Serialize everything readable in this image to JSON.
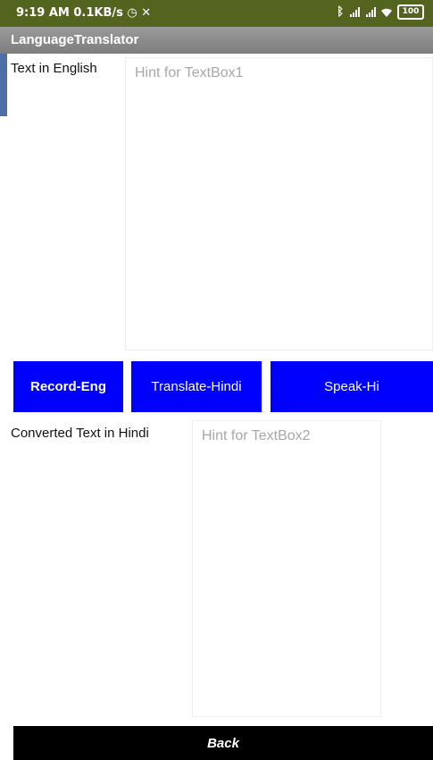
{
  "status_bar": {
    "time": "9:19 AM",
    "net_speed": "0.1KB/s",
    "alarm_icon": "alarm-icon",
    "x_icon": "✕",
    "battery": "100"
  },
  "app": {
    "title": "LanguageTranslator"
  },
  "english": {
    "label": "Text in English",
    "placeholder": "Hint for TextBox1"
  },
  "buttons": {
    "record": "Record-Eng",
    "translate": "Translate-Hindi",
    "speak": "Speak-Hi",
    "back": "Back"
  },
  "hindi": {
    "label": "Converted Text in Hindi",
    "placeholder": "Hint for TextBox2"
  },
  "colors": {
    "status_bar": "#53641f",
    "title_bar": "#8a8a8a",
    "buttons": "#0000ff",
    "back_button": "#000000"
  }
}
